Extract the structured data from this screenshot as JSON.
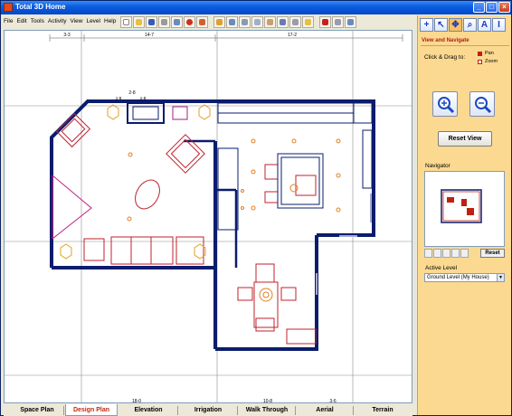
{
  "window": {
    "title": "Total 3D Home",
    "min": "_",
    "max": "□",
    "close": "×"
  },
  "menu": [
    "File",
    "Edit",
    "Tools",
    "Activity",
    "View",
    "Level",
    "Help"
  ],
  "toolbar": {
    "icons": [
      "new-icon",
      "open-icon",
      "save-icon",
      "print-icon",
      "undo-icon",
      "help-icon",
      "pointer-help-icon",
      "catalog-icon",
      "walls-icon",
      "doors-icon",
      "windows-icon",
      "furniture-icon",
      "materials-icon",
      "appliances-icon",
      "roofs-icon",
      "lights-icon",
      "text-icon",
      "3d-icon"
    ]
  },
  "plan": {
    "dims_top": [
      "3-3",
      "14-7",
      "17-2"
    ],
    "dim_small": [
      "2-8",
      "1-8",
      "1-8"
    ],
    "dims_bottom": [
      "18-0",
      "10-8",
      "3-6"
    ]
  },
  "tabs": [
    "Space Plan",
    "Design Plan",
    "Elevation",
    "Irrigation",
    "Walk Through",
    "Aerial",
    "Terrain"
  ],
  "active_tab": "Design Plan",
  "panel": {
    "tools": [
      "+",
      "↖",
      "✥",
      "⌕",
      "A",
      "I"
    ],
    "title": "View and Navigate",
    "click_drag": "Click & Drag to:",
    "legend": [
      {
        "label": "Pan",
        "color": "#c02010"
      },
      {
        "label": "Zoom",
        "color": "#ffffff"
      }
    ],
    "reset_view": "Reset View",
    "navigator_label": "Navigator",
    "navigator_reset": "Reset",
    "active_level_label": "Active Level",
    "active_level_value": "Ground Level (My House)",
    "select_arrow": "▼"
  },
  "colors": {
    "accent": "#0a5ee0",
    "panel": "#fcd991",
    "wall": "#0a1c6c",
    "furniture": "#c0202c"
  }
}
